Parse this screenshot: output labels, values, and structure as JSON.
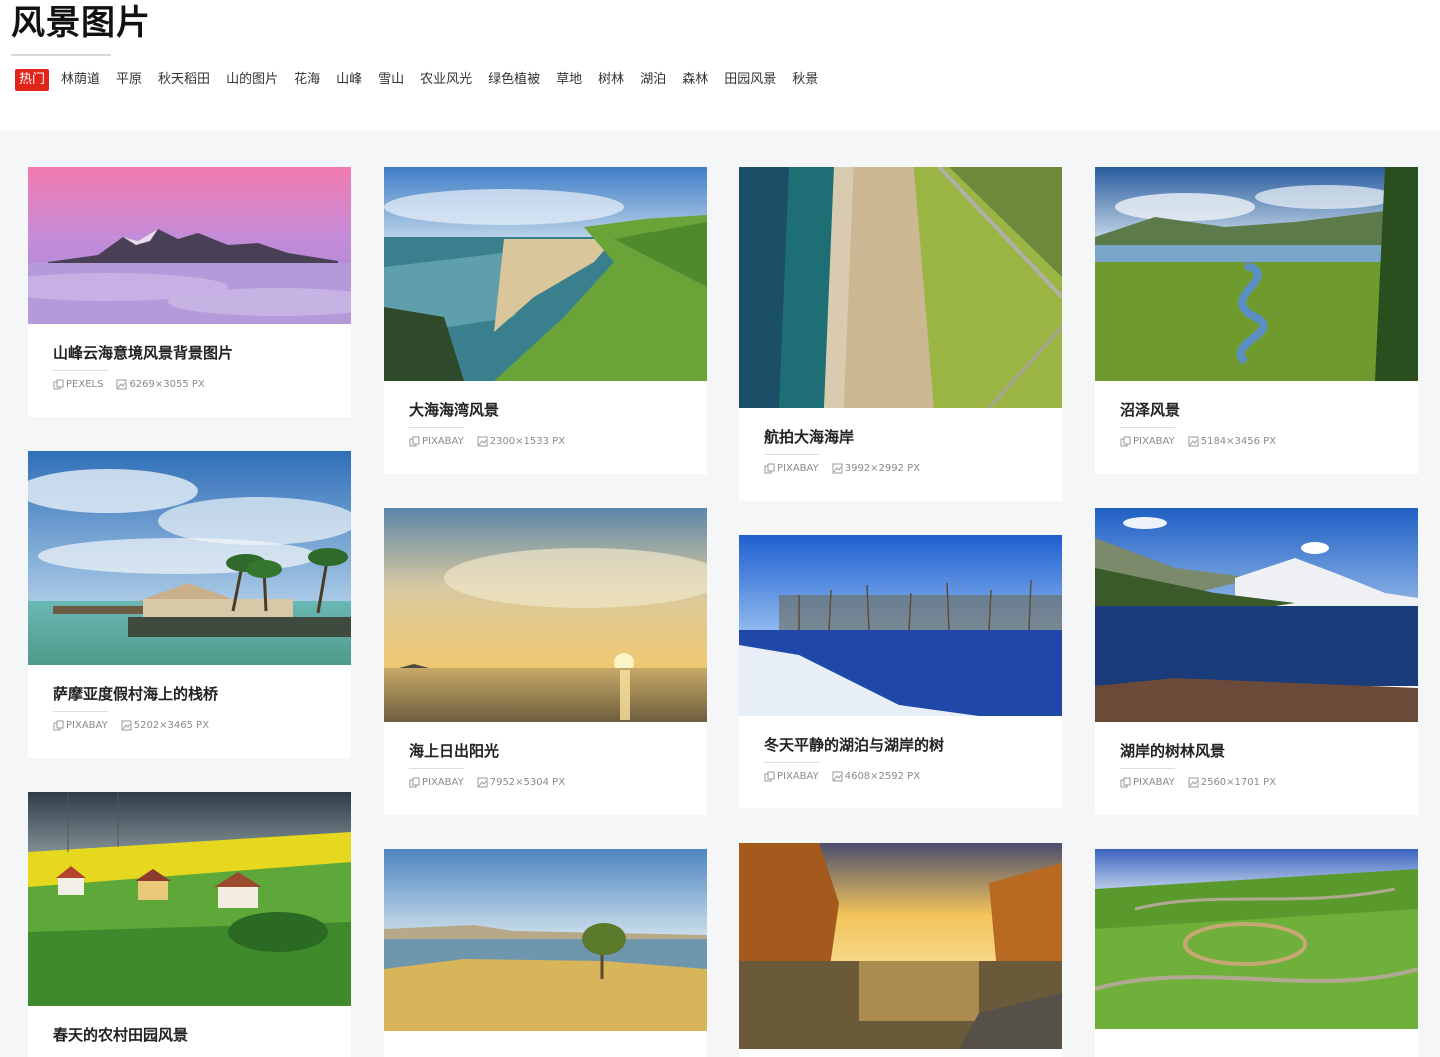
{
  "page": {
    "title": "风景图片"
  },
  "tags": [
    "热门",
    "林荫道",
    "平原",
    "秋天稻田",
    "山的图片",
    "花海",
    "山峰",
    "雪山",
    "农业风光",
    "绿色植被",
    "草地",
    "树林",
    "湖泊",
    "森林",
    "田园风景",
    "秋景"
  ],
  "cards": [
    {
      "title": "山峰云海意境风景背景图片",
      "source": "PEXELS",
      "size": "6269×3055 PX"
    },
    {
      "title": "萨摩亚度假村海上的栈桥",
      "source": "PIXABAY",
      "size": "5202×3465 PX"
    },
    {
      "title": "春天的农村田园风景",
      "source": "",
      "size": ""
    },
    {
      "title": "大海海湾风景",
      "source": "PIXABAY",
      "size": "2300×1533 PX"
    },
    {
      "title": "海上日出阳光",
      "source": "PIXABAY",
      "size": "7952×5304 PX"
    },
    {
      "title": "",
      "source": "",
      "size": ""
    },
    {
      "title": "航拍大海海岸",
      "source": "PIXABAY",
      "size": "3992×2992 PX"
    },
    {
      "title": "冬天平静的湖泊与湖岸的树",
      "source": "PIXABAY",
      "size": "4608×2592 PX"
    },
    {
      "title": "",
      "source": "",
      "size": ""
    },
    {
      "title": "沼泽风景",
      "source": "PIXABAY",
      "size": "5184×3456 PX"
    },
    {
      "title": "湖岸的树林风景",
      "source": "PIXABAY",
      "size": "2560×1701 PX"
    },
    {
      "title": "",
      "source": "",
      "size": ""
    }
  ],
  "colors": {
    "hot_tag": "#e2231a",
    "background": "#f5f6f8"
  },
  "icons": {
    "source": "copy-icon",
    "size": "image-icon"
  }
}
